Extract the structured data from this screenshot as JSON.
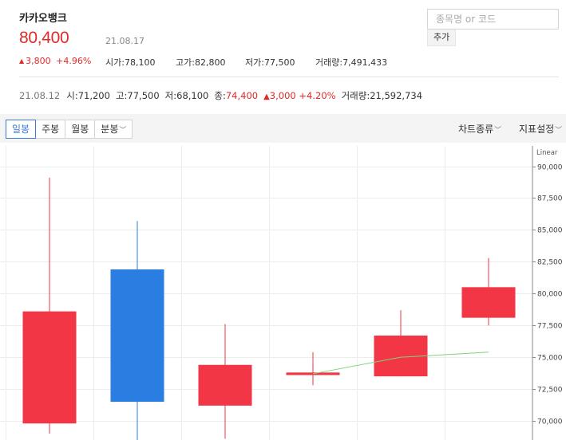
{
  "stock": {
    "name": "카카오뱅크",
    "price": "80,400",
    "date": "21.08.17",
    "change_amount": "3,800",
    "change_pct": "+4.96%"
  },
  "stats": {
    "open_label": "시가",
    "open": "78,100",
    "high_label": "고가",
    "high": "82,800",
    "low_label": "저가",
    "low": "77,500",
    "volume_label": "거래량",
    "volume": "7,491,433"
  },
  "search": {
    "placeholder": "종목명 or 코드",
    "value": "",
    "add_label": "추가"
  },
  "prev_day": {
    "date": "21.08.12",
    "open_label": "시",
    "open": "71,200",
    "high_label": "고",
    "high": "77,500",
    "low_label": "저",
    "low": "68,100",
    "close_label": "종",
    "close": "74,400",
    "change": "3,000",
    "change_pct": "+4.20%",
    "volume_label": "거래량",
    "volume": "21,592,734"
  },
  "toolbar": {
    "tabs": [
      "일봉",
      "주봉",
      "월봉",
      "분봉"
    ],
    "active_tab": 0,
    "chart_type_label": "차트종류",
    "indicator_label": "지표설정"
  },
  "colors": {
    "up": "#f23645",
    "down": "#2a7de1",
    "ma": "#7cd67c",
    "accent": "#3a7bd5"
  },
  "chart_data": {
    "type": "candlestick",
    "scale_label": "Linear",
    "ylim": [
      68500,
      91600
    ],
    "y_ticks": [
      70000,
      72500,
      75000,
      77500,
      80000,
      82500,
      85000,
      87500,
      90000
    ],
    "candles": [
      {
        "open": 78600,
        "high": 89100,
        "low": 69000,
        "close": 69800,
        "color": "up"
      },
      {
        "open": 81900,
        "high": 85700,
        "low": 68500,
        "close": 71500,
        "color": "down"
      },
      {
        "open": 74400,
        "high": 77600,
        "low": 68600,
        "close": 71200,
        "color": "up"
      },
      {
        "open": 73600,
        "high": 75400,
        "low": 72800,
        "close": 73800,
        "color": "up"
      },
      {
        "open": 76700,
        "high": 78700,
        "low": 73500,
        "close": 73500,
        "color": "up"
      },
      {
        "open": 78100,
        "high": 82800,
        "low": 77500,
        "close": 80500,
        "color": "up"
      }
    ],
    "ma_line": [
      null,
      null,
      null,
      73700,
      75000,
      75400
    ]
  }
}
